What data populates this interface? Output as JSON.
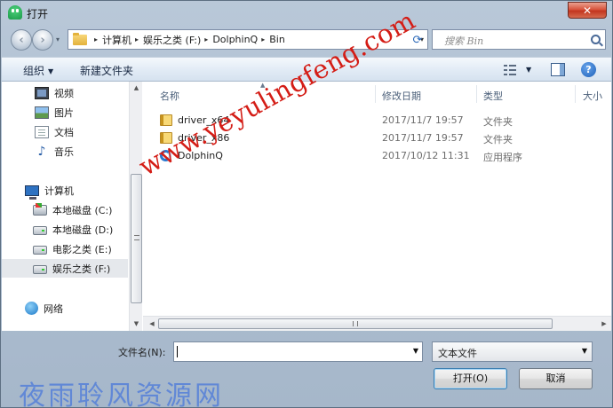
{
  "window": {
    "title": "打开",
    "close_glyph": "✕"
  },
  "nav": {
    "back_glyph": "‹",
    "forward_glyph": "›",
    "history_glyph": "▾",
    "address": {
      "crumbs": [
        "计算机",
        "娱乐之类 (F:)",
        "DolphinQ",
        "Bin"
      ],
      "separator": "▸",
      "dropdown_glyph": "▾"
    },
    "refresh_glyph": "⟳",
    "search_placeholder": "搜索 Bin"
  },
  "toolbar": {
    "organize_label": "组织",
    "organize_caret": "▼",
    "new_folder_label": "新建文件夹",
    "view_caret": "▼",
    "help_glyph": "?"
  },
  "sidebar": {
    "libraries": [
      {
        "label": "视频",
        "icon": "video-icon"
      },
      {
        "label": "图片",
        "icon": "pictures-icon"
      },
      {
        "label": "文档",
        "icon": "documents-icon"
      },
      {
        "label": "音乐",
        "icon": "music-icon"
      }
    ],
    "computer": {
      "label": "计算机",
      "icon": "computer-icon"
    },
    "drives": [
      {
        "label": "本地磁盘 (C:)",
        "icon": "system-drive-icon",
        "selected": false
      },
      {
        "label": "本地磁盘 (D:)",
        "icon": "drive-icon",
        "selected": false
      },
      {
        "label": "电影之类 (E:)",
        "icon": "drive-icon",
        "selected": false
      },
      {
        "label": "娱乐之类 (F:)",
        "icon": "drive-icon",
        "selected": true
      }
    ],
    "network": {
      "label": "网络",
      "icon": "network-icon"
    },
    "music_glyph": "♪",
    "scroll_up_glyph": "▲",
    "scroll_down_glyph": "▼"
  },
  "files": {
    "columns": {
      "name": "名称",
      "date": "修改日期",
      "type": "类型",
      "size": "大小"
    },
    "sort_glyph": "▲",
    "rows": [
      {
        "name": "driver_x64",
        "date": "2017/11/7 19:57",
        "type": "文件夹",
        "icon": "folder-icon"
      },
      {
        "name": "driver_x86",
        "date": "2017/11/7 19:57",
        "type": "文件夹",
        "icon": "folder-icon"
      },
      {
        "name": "DolphinQ",
        "date": "2017/10/12 11:31",
        "type": "应用程序",
        "icon": "application-icon"
      }
    ],
    "hscroll_left_glyph": "◀",
    "hscroll_right_glyph": "▶"
  },
  "bottom": {
    "filename_label": "文件名(N):",
    "filename_value": "",
    "filename_dropdown_glyph": "▼",
    "filetype_value": "文本文件",
    "filetype_dropdown_glyph": "▼",
    "open_button": "打开(O)",
    "cancel_button": "取消"
  },
  "watermarks": {
    "url": "www.yeyulingfeng.com",
    "site_name": "夜雨聆风资源网"
  },
  "colors": {
    "accent": "#2a68b8",
    "selection": "#e5e8ec",
    "watermark_red": "#d41d16",
    "watermark_blue": "#5a83d8"
  }
}
